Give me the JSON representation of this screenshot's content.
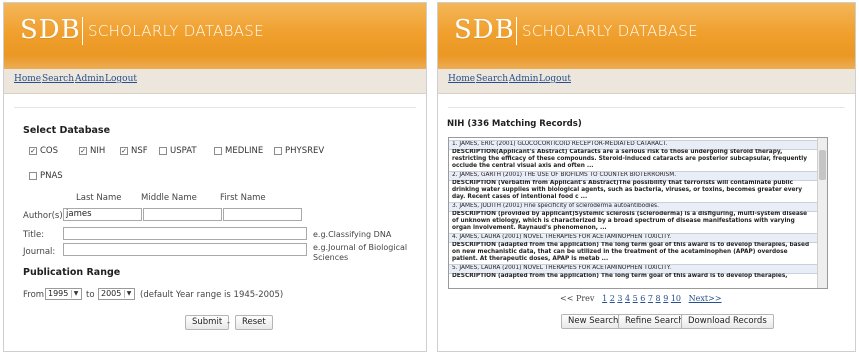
{
  "brand": {
    "logo": "SDB",
    "name": "SCHOLARLY DATABASE",
    "header_color": "#f0a02e"
  },
  "nav": {
    "items": [
      "Home",
      "Search",
      "Admin",
      "Logout"
    ]
  },
  "search_form": {
    "select_db_title": "Select Database",
    "databases": [
      {
        "label": "COS",
        "checked": true
      },
      {
        "label": "NIH",
        "checked": true
      },
      {
        "label": "NSF",
        "checked": true
      },
      {
        "label": "USPAT",
        "checked": false
      },
      {
        "label": "MEDLINE",
        "checked": false
      },
      {
        "label": "PHYSREV",
        "checked": false
      },
      {
        "label": "PNAS",
        "checked": false
      }
    ],
    "col_last_name": "Last Name",
    "col_middle_name": "Middle Name",
    "col_first_name": "First Name",
    "authors_label": "Author(s)",
    "author_last_value": "james",
    "title_label": "Title:",
    "title_hint": "e.g.Classifying DNA",
    "journal_label": "Journal:",
    "journal_hint": "e.g.Journal of Biological Sciences",
    "pub_range_title": "Publication Range",
    "from_label": "From",
    "from_value": "1995",
    "to_label": "to",
    "to_value": "2005",
    "range_note": "(default Year range is 1945-2005)",
    "submit_label": "Submit",
    "separator": "-",
    "reset_label": "Reset"
  },
  "results": {
    "title": "NIH (336 Matching Records)",
    "records": [
      {
        "head": "1. JAMES, ERIC (2001) GLUCOCORTICOID RECEPTOR-MEDIATED CATARACT.",
        "body": "DESCRIPTION(Applicant's Abstract) Cataracts are a serious risk to those undergoing steroid therapy, restricting the efficacy of these compounds. Steroid-induced cataracts are posterior subcapsular, frequently occlude the central visual axis and often ..."
      },
      {
        "head": "2. JAMES, GARTH (2001) THE USE OF BIOFILMS TO COUNTER BIOTERRORISM.",
        "body": "DESCRIPTION (Verbatim from Applicant's Abstract)The possibility that terrorists will contaminate public drinking water supplies with biological agents, such as bacteria, viruses, or toxins, becomes greater every day. Recent cases of intentional food c ..."
      },
      {
        "head": "3. JAMES, JUDITH (2001) Fine specificity of scleroderma autoantibodies.",
        "body": "DESCRIPTION (provided by applicant)Systemic sclerosis (scleroderma) is a disfiguring, multi-system disease of unknown etiology, which is characterized by a broad spectrum of disease manifestations with varying organ involvement. Raynaud's phenomenon, ..."
      },
      {
        "head": "4. JAMES, LAURA (2001) NOVEL THERAPIES FOR ACETAMINOPHEN TOXICITY.",
        "body": "DESCRIPTION (adapted from the application) The long term goal of this award is to develop therapies, based on new mechanistic data, that can be utilized in the treatment of the acetaminophen (APAP) overdose patient. At therapeutic doses, APAP is metab ..."
      },
      {
        "head": "5. JAMES, LAURA (2001) NOVEL THERAPIES FOR ACETAMINOPHEN TOXICITY.",
        "body": "DESCRIPTION (adapted from the application) The long term goal of this award is to develop therapies,"
      }
    ],
    "pager": {
      "prev": "<< Prev",
      "pages": [
        "1",
        "2",
        "3",
        "4",
        "5",
        "6",
        "7",
        "8",
        "9",
        "10"
      ],
      "next": "Next>>"
    },
    "buttons": {
      "new_search": "New Search",
      "refine_search": "Refine Search",
      "download_records": "Download Records"
    }
  }
}
